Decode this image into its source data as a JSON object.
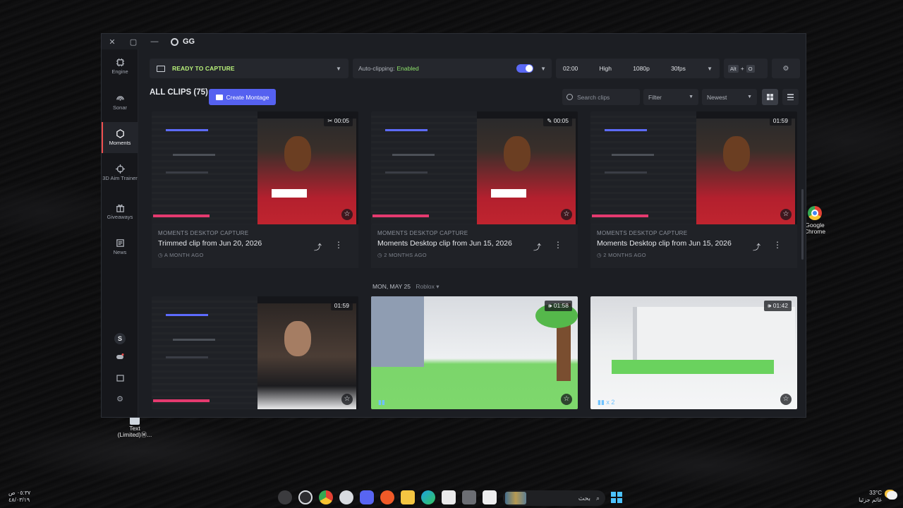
{
  "desktop": {
    "chrome_label": "Google Chrome",
    "text_label": "Text (Limited)Ⓜ..."
  },
  "app": {
    "title": "GG",
    "titlebar": {
      "close": "✕",
      "restore": "▢",
      "minimize": "—"
    }
  },
  "sidebar": {
    "items": [
      {
        "label": "Engine",
        "icon": "chip-icon"
      },
      {
        "label": "Sonar",
        "icon": "sonar-icon"
      },
      {
        "label": "Moments",
        "icon": "hexagon-icon",
        "active": true
      },
      {
        "label": "3D Aim Trainer",
        "icon": "crosshair-icon"
      },
      {
        "label": "Giveaways",
        "icon": "gift-icon"
      },
      {
        "label": "News",
        "icon": "news-icon"
      }
    ],
    "avatar_letter": "S"
  },
  "capture": {
    "status": "READY TO CAPTURE",
    "autoclip_label": "Auto-clipping:",
    "autoclip_value": "Enabled",
    "duration": "02:00",
    "quality": "High",
    "resolution": "1080p",
    "fps": "30fps",
    "hotkey_mod": "Alt",
    "hotkey_sep": "+",
    "hotkey_key": "O",
    "status_color": "#b9f27a",
    "toggle_color": "#5b69f5"
  },
  "toolbar": {
    "clips_heading": "ALL CLIPS (75)",
    "montage_label": "Create Montage",
    "search_placeholder": "Search clips",
    "filter_label": "Filter",
    "sort_label": "Newest"
  },
  "clips": [
    {
      "source": "MOMENTS DESKTOP CAPTURE",
      "title": "Trimmed clip from Jun 20, 2026",
      "ago": "A MONTH AGO",
      "duration": "00:05",
      "badge": "✂"
    },
    {
      "source": "MOMENTS DESKTOP CAPTURE",
      "title": "Moments Desktop clip from Jun 15, 2026",
      "ago": "2 MONTHS AGO",
      "duration": "00:05",
      "badge": "✎"
    },
    {
      "source": "MOMENTS DESKTOP CAPTURE",
      "title": "Moments Desktop clip from Jun 15, 2026",
      "ago": "2 MONTHS AGO",
      "duration": "01:59",
      "badge": ""
    },
    {
      "duration": "01:59",
      "badge": ""
    },
    {
      "duration": "01:58",
      "badge": "🕪"
    },
    {
      "duration": "01:42",
      "badge": "🕪",
      "audio_count": "x 2"
    }
  ],
  "date_group": {
    "date": "MON, MAY 25",
    "game": "Roblox"
  },
  "taskbar": {
    "search_text": "بحث",
    "time": "٠٥:٣٧ ص",
    "date": "٤٨/٠٣/١٩",
    "temp": "33°C",
    "weather": "غائم جزئيا"
  }
}
